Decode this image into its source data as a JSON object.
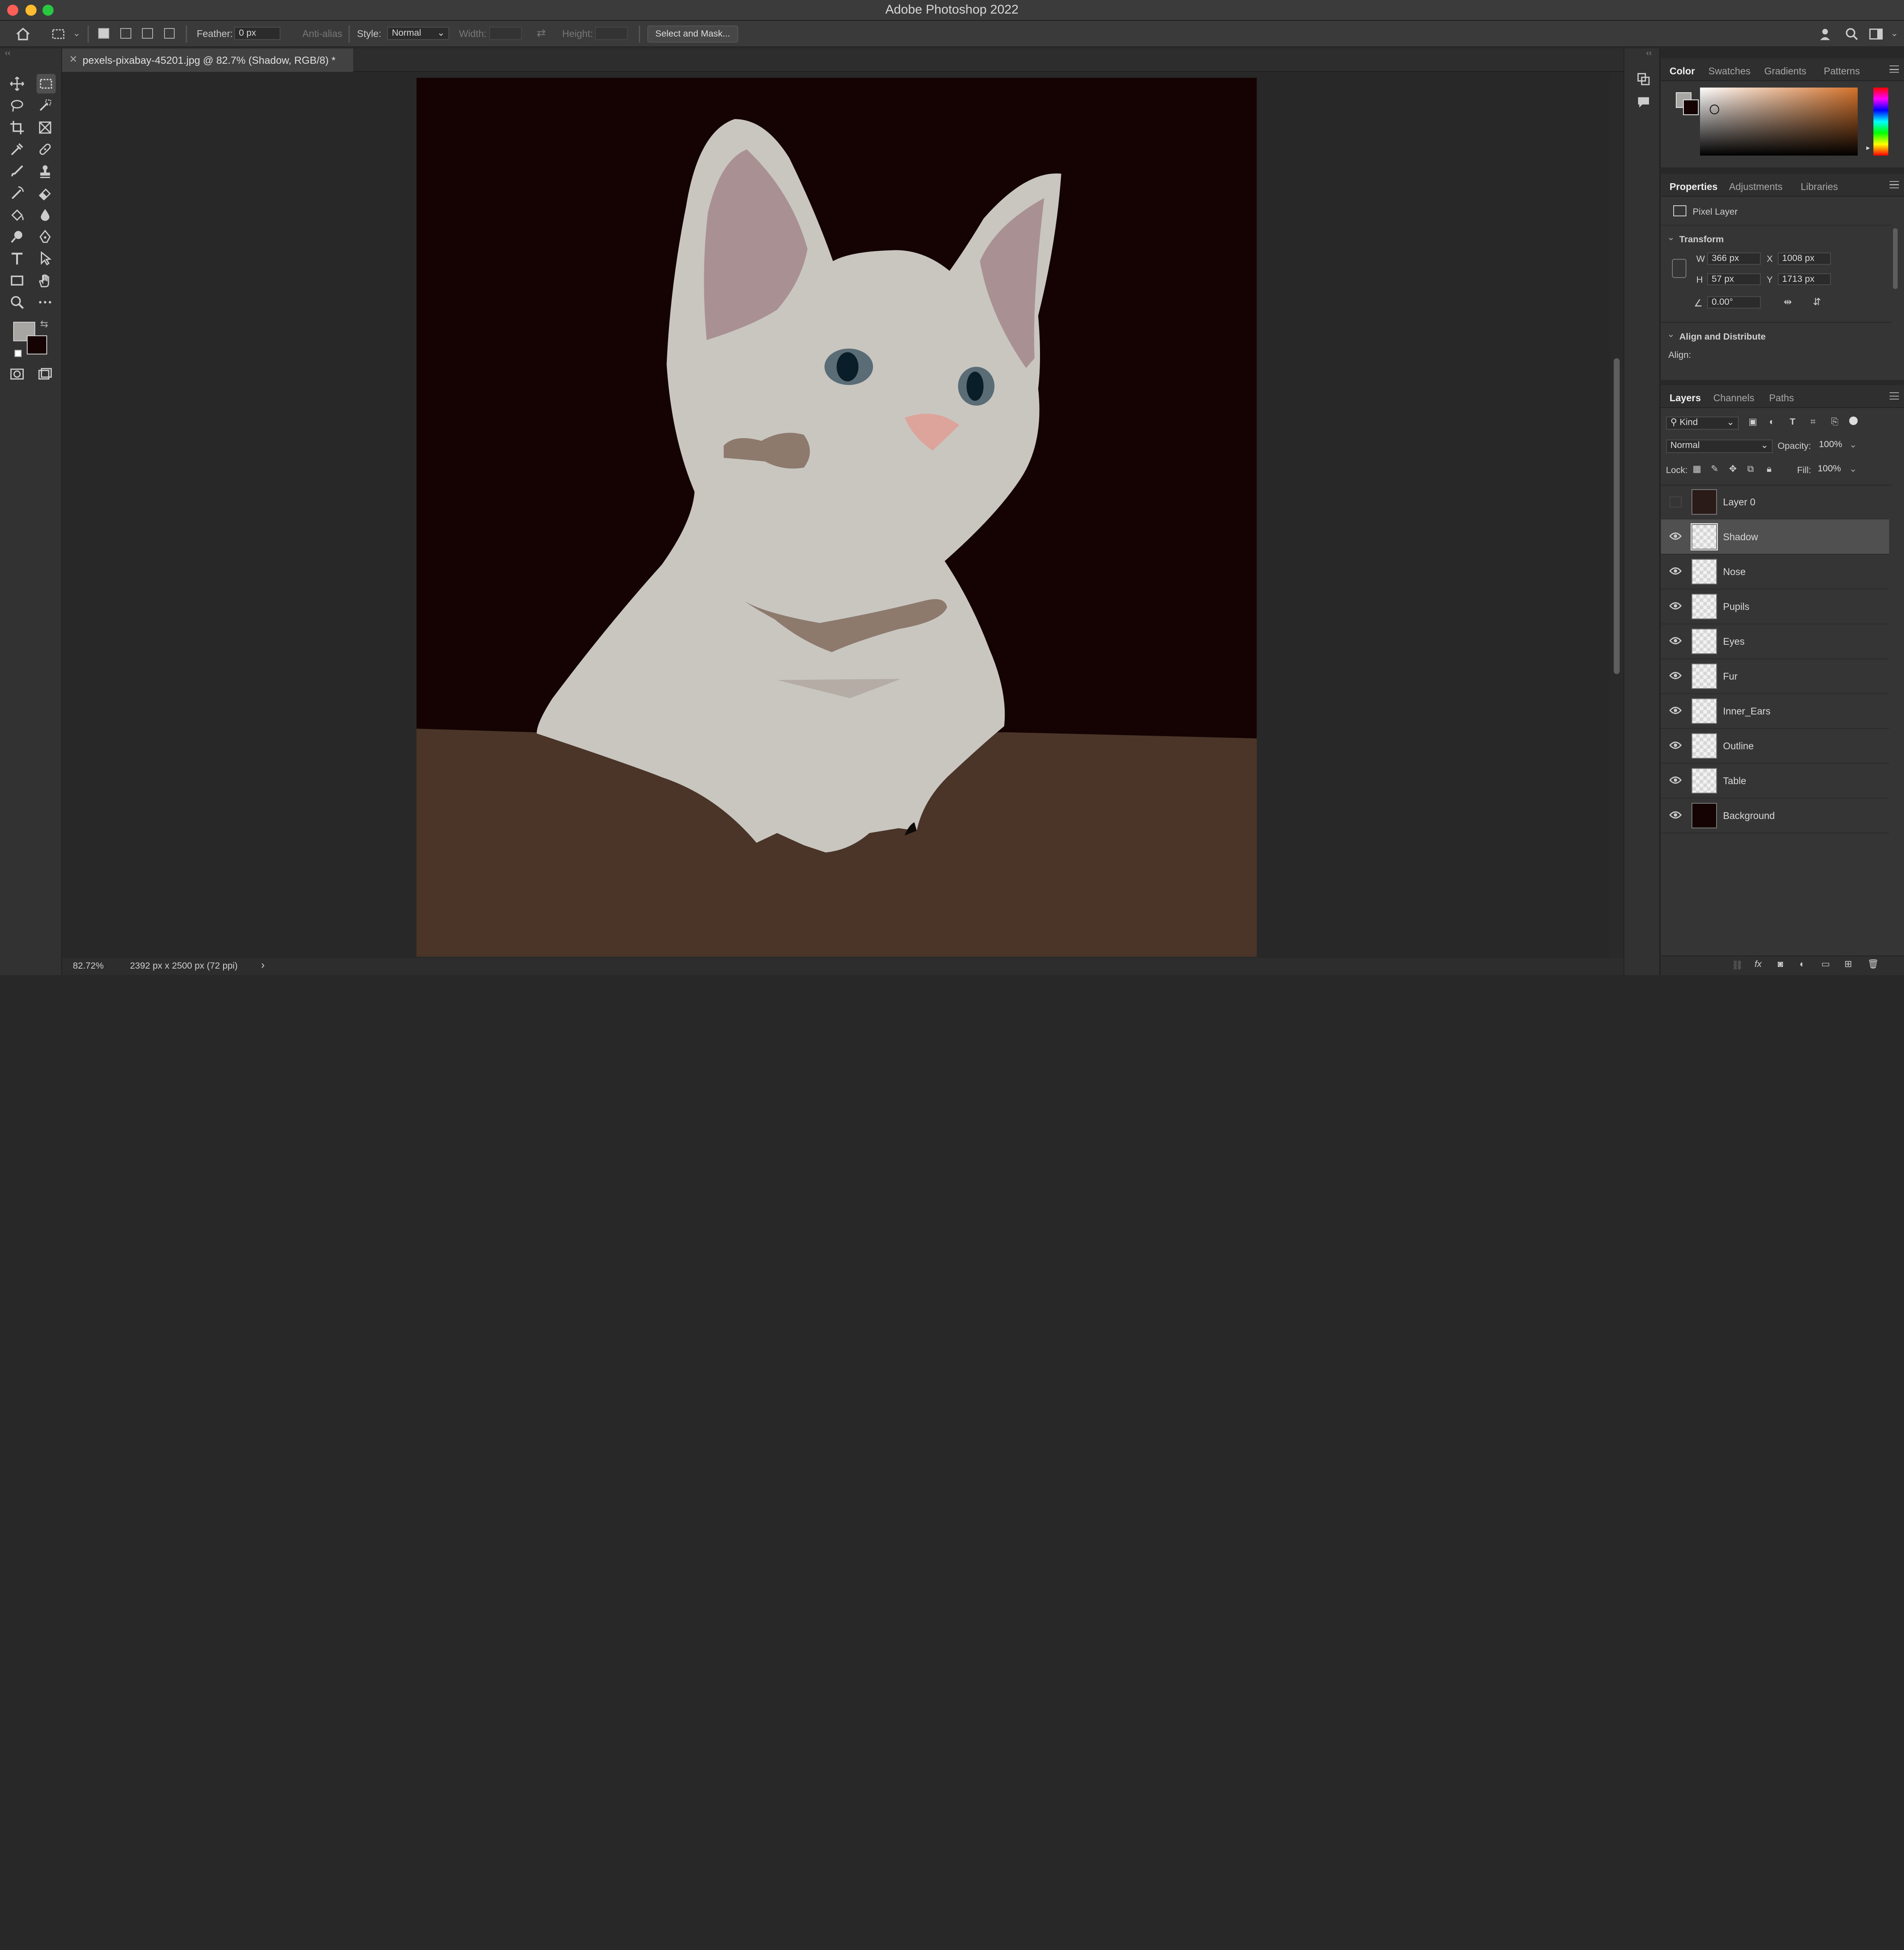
{
  "app": {
    "title": "Adobe Photoshop 2022"
  },
  "options": {
    "feather_label": "Feather:",
    "feather_value": "0 px",
    "antialias_label": "Anti-alias",
    "style_label": "Style:",
    "style_value": "Normal",
    "width_label": "Width:",
    "height_label": "Height:",
    "select_mask_label": "Select and Mask..."
  },
  "document": {
    "tab_title": "pexels-pixabay-45201.jpg @ 82.7% (Shadow, RGB/8) *"
  },
  "status": {
    "zoom": "82.72%",
    "doc_info": "2392 px x 2500 px (72 ppi)",
    "arrow": "›"
  },
  "color_panel": {
    "tabs": [
      "Color",
      "Swatches",
      "Gradients",
      "Patterns"
    ]
  },
  "properties_panel": {
    "tabs": [
      "Properties",
      "Adjustments",
      "Libraries"
    ],
    "layer_type": "Pixel Layer",
    "transform_title": "Transform",
    "w_label": "W",
    "w_value": "366 px",
    "x_label": "X",
    "x_value": "1008 px",
    "h_label": "H",
    "h_value": "57 px",
    "y_label": "Y",
    "y_value": "1713 px",
    "angle_value": "0.00°",
    "align_title": "Align and Distribute",
    "align_label": "Align:"
  },
  "layers_panel": {
    "tabs": [
      "Layers",
      "Channels",
      "Paths"
    ],
    "kind_label": "Kind",
    "blend_mode": "Normal",
    "opacity_label": "Opacity:",
    "opacity_value": "100%",
    "lock_label": "Lock:",
    "fill_label": "Fill:",
    "fill_value": "100%",
    "layers": [
      {
        "name": "Layer 0",
        "visible": false,
        "selected": false
      },
      {
        "name": "Shadow",
        "visible": true,
        "selected": true
      },
      {
        "name": "Nose",
        "visible": true,
        "selected": false
      },
      {
        "name": "Pupils",
        "visible": true,
        "selected": false
      },
      {
        "name": "Eyes",
        "visible": true,
        "selected": false
      },
      {
        "name": "Fur",
        "visible": true,
        "selected": false
      },
      {
        "name": "Inner_Ears",
        "visible": true,
        "selected": false
      },
      {
        "name": "Outline",
        "visible": true,
        "selected": false
      },
      {
        "name": "Table",
        "visible": true,
        "selected": false
      },
      {
        "name": "Background",
        "visible": true,
        "selected": false
      }
    ]
  },
  "colors": {
    "foreground": "#a8a6a2",
    "background": "#150303",
    "accent": "#505050"
  }
}
